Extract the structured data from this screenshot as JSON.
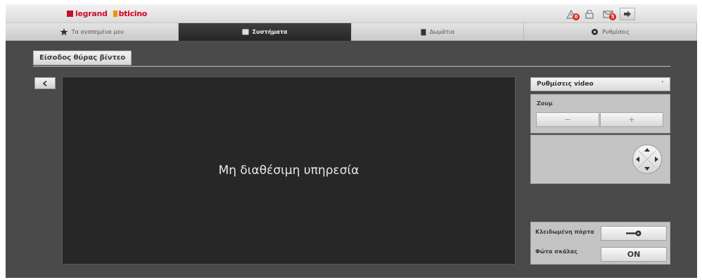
{
  "brand": {
    "part1": "legrand",
    "part2": "bticino"
  },
  "toolbar": {
    "alarm_badge": "0",
    "mail_badge": "5"
  },
  "nav": [
    {
      "label": "Τα αγαπημένα μου",
      "icon": "star-icon"
    },
    {
      "label": "Συστήματα",
      "icon": "systems-icon"
    },
    {
      "label": "Δωμάτια",
      "icon": "rooms-icon"
    },
    {
      "label": "Ρυθμίσεις",
      "icon": "settings-icon"
    }
  ],
  "page": {
    "title": "Είσοδος θύρας βίντεο"
  },
  "video": {
    "message": "Μη διαθέσιμη υπηρεσία"
  },
  "video_settings": {
    "header": "Ρυθμίσεις video",
    "zoom_label": "Ζουμ",
    "zoom_minus": "−",
    "zoom_plus": "+"
  },
  "door": {
    "locked_label": "Κλειδωμένη πόρτα",
    "stairs_label": "Φώτα σκάλας",
    "stairs_value": "ON"
  },
  "colors": {
    "brand_red": "#c8102e",
    "brand_orange": "#f29100",
    "badge_red": "#d8231e",
    "active_nav": "#2e2e2e"
  }
}
